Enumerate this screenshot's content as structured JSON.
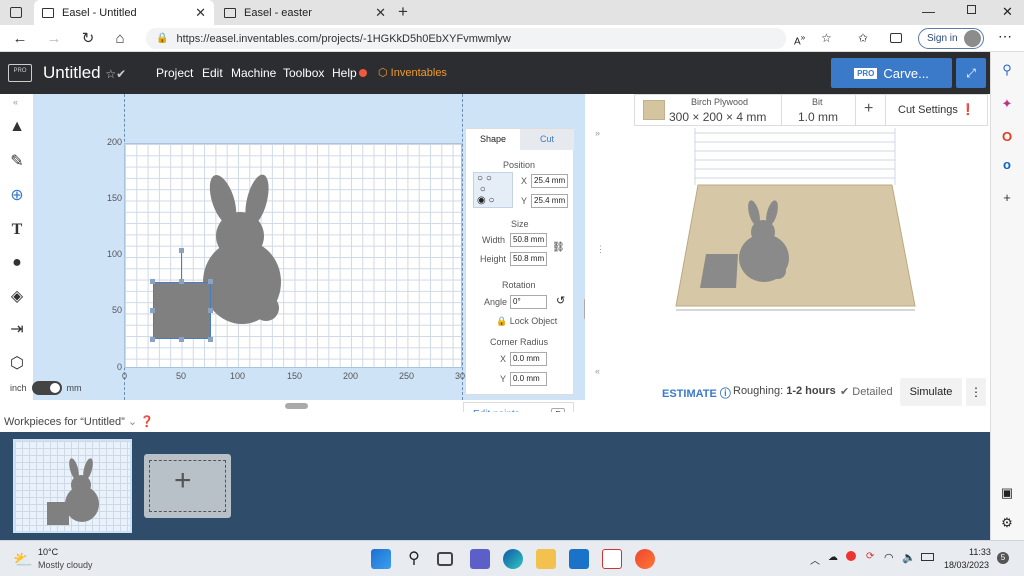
{
  "browser": {
    "tabs": [
      {
        "title": "Easel - Untitled",
        "active": true
      },
      {
        "title": "Easel - easter",
        "active": false
      }
    ],
    "new_tab_icon": "plus-icon",
    "url": "https://easel.inventables.com/projects/-1HGKkD5h0EbXYFvmwmlyw",
    "signin_label": "Sign in"
  },
  "app": {
    "pro_label": "PRO",
    "title": "Untitled",
    "menu": [
      "Project",
      "Edit",
      "Machine",
      "Toolbox",
      "Help"
    ],
    "brand": "Inventables",
    "carve_badge": "PRO",
    "carve_label": "Carve..."
  },
  "canvas": {
    "y_ticks": [
      "200",
      "150",
      "100",
      "50",
      "0"
    ],
    "x_ticks": [
      "0",
      "50",
      "100",
      "150",
      "200",
      "250",
      "30"
    ],
    "unit_left": "inch",
    "unit_right": "mm"
  },
  "shape_panel": {
    "tab_shape": "Shape",
    "tab_cut": "Cut",
    "position_label": "Position",
    "x_label": "X",
    "x_value": "25.4 mm",
    "y_label": "Y",
    "y_value": "25.4 mm",
    "size_label": "Size",
    "width_label": "Width",
    "width_value": "50.8 mm",
    "height_label": "Height",
    "height_value": "50.8 mm",
    "rotation_label": "Rotation",
    "angle_label": "Angle",
    "angle_value": "0°",
    "lock_label": "Lock Object",
    "corner_label": "Corner Radius",
    "cx_label": "X",
    "cx_value": "0.0 mm",
    "cy_label": "Y",
    "cy_value": "0.0 mm",
    "edit_points": "Edit points",
    "edit_key": "E"
  },
  "material": {
    "name": "Birch Plywood",
    "dims": "300 × 200 × 4 mm",
    "bit_label": "Bit",
    "bit_value": "1.0 mm",
    "plus": "+",
    "cut_settings": "Cut Settings"
  },
  "estimate": {
    "estimate_label": "ESTIMATE",
    "roughing_label": "Roughing:",
    "roughing_value": "1-2 hours",
    "detailed_label": "Detailed",
    "simulate_label": "Simulate"
  },
  "workpieces": {
    "header": "Workpieces for “Untitled”"
  },
  "taskbar": {
    "weather_temp": "10°C",
    "weather_desc": "Mostly cloudy",
    "time": "11:33",
    "date": "18/03/2023",
    "notif_count": "5"
  },
  "colors": {
    "accent": "#3a7ac9",
    "header_bg": "#2b2d30",
    "canvas_bg": "#cfe3f7",
    "tray_bg": "#2f4d6a",
    "brand_orange": "#f29a2e",
    "shape_gray": "#808080",
    "wood": "#d4c4a0"
  }
}
